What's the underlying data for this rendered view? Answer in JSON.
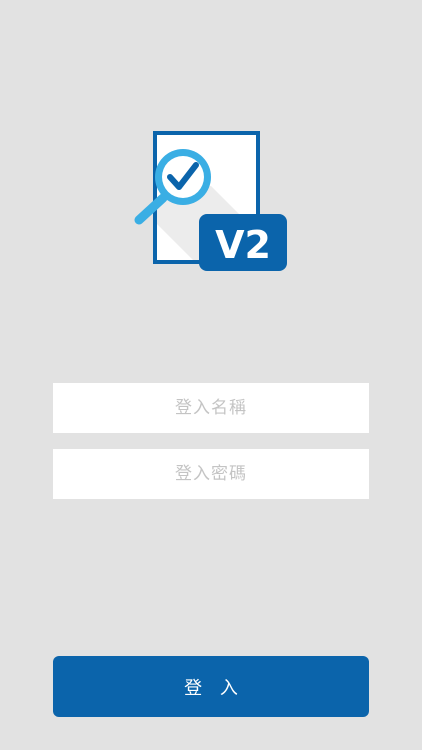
{
  "app": {
    "logo_icon": "document-magnifier-check-icon",
    "version_badge": "V2"
  },
  "form": {
    "username_placeholder": "登入名稱",
    "password_placeholder": "登入密碼",
    "username_value": "",
    "password_value": ""
  },
  "actions": {
    "login_label": "登 入"
  },
  "colors": {
    "background": "#e2e2e2",
    "primary": "#0b64ab",
    "accent": "#3aaee4",
    "input_background": "#ffffff",
    "placeholder": "#c4c4c4"
  }
}
